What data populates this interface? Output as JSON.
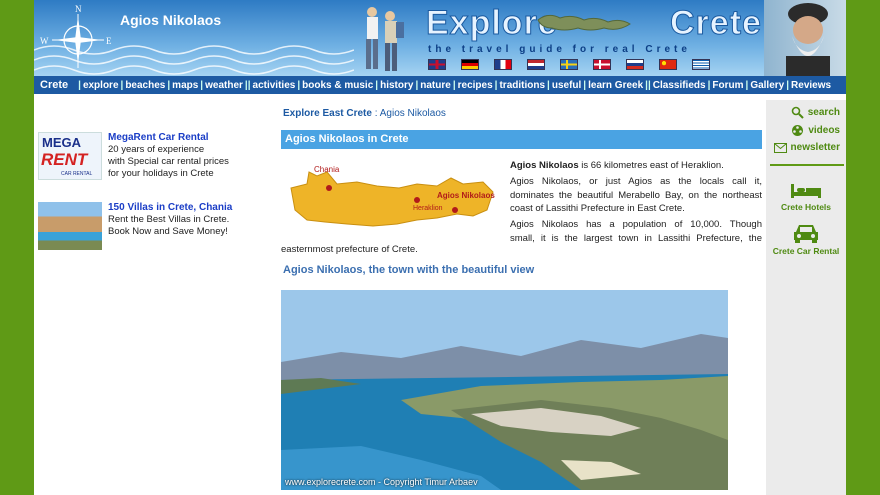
{
  "header": {
    "town_title": "Agios Nikolaos",
    "logo_left": "Explore",
    "logo_right": "Crete",
    "tagline": "the travel guide for real Crete",
    "compass": {
      "n": "N",
      "w": "W",
      "e": "E",
      "s": "S"
    },
    "flags": [
      {
        "name": "uk-flag-icon",
        "color": "#1f3d8a"
      },
      {
        "name": "germany-flag-icon",
        "color": "#000000"
      },
      {
        "name": "france-flag-icon",
        "color": "#1f3d8a"
      },
      {
        "name": "netherlands-flag-icon",
        "color": "#c0272d"
      },
      {
        "name": "sweden-flag-icon",
        "color": "#2a6ebb"
      },
      {
        "name": "denmark-flag-icon",
        "color": "#c8102e"
      },
      {
        "name": "russia-flag-icon",
        "color": "#ffffff"
      },
      {
        "name": "china-flag-icon",
        "color": "#de2910"
      },
      {
        "name": "greece-flag-icon",
        "color": "#0d5eaf"
      }
    ]
  },
  "nav": {
    "home": "Crete",
    "items": [
      "explore",
      "beaches",
      "maps",
      "weather",
      "activities",
      "books & music",
      "history",
      "nature",
      "recipes",
      "traditions",
      "useful",
      "learn Greek",
      "Classifieds",
      "Forum",
      "Gallery",
      "Reviews"
    ]
  },
  "ads": [
    {
      "logo_top": "MEGA",
      "logo_mid": "RENT",
      "logo_bottom": "CAR RENTAL",
      "title": "MegaRent Car Rental",
      "lines": [
        "20 years of experience",
        "with Special car rental prices",
        "for your holidays in Crete"
      ]
    },
    {
      "title": "150 Villas in Crete, Chania",
      "lines": [
        "Rent the Best Villas in Crete.",
        "Book Now and Save Money!"
      ]
    }
  ],
  "breadcrumb": {
    "parent": "Explore East Crete",
    "separator": " : ",
    "current": "Agios Nikolaos"
  },
  "section_header": "Agios Nikolaos in Crete",
  "map_labels": {
    "chania": "Chania",
    "heraklion": "Heraklion",
    "agios": "Agios Nikolaos"
  },
  "intro": {
    "p1_bold": "Agios Nikolaos",
    "p1_rest": " is 66 kilometres east of Heraklion.",
    "p2_lines": [
      "Agios Nikolaos, or just Agios as the locals call it,",
      "dominates the beautiful Merabello Bay, on the northeast",
      "coast of Lassithi Prefecture in East Crete."
    ],
    "p3_lines": [
      "Agios Nikolaos has a population of 10,000. Though",
      "small, it is the largest town in Lassithi Prefecture, the"
    ],
    "p3_tail": "easternmost prefecture of Crete."
  },
  "subheader": "Agios Nikolaos, the town with the beautiful view",
  "photo_credit": "www.explorecrete.com - Copyright Timur Arbaev",
  "sidebar": {
    "search": "search",
    "videos": "videos",
    "newsletter": "newsletter",
    "hotels": "Crete Hotels",
    "car_rental": "Crete Car Rental"
  }
}
